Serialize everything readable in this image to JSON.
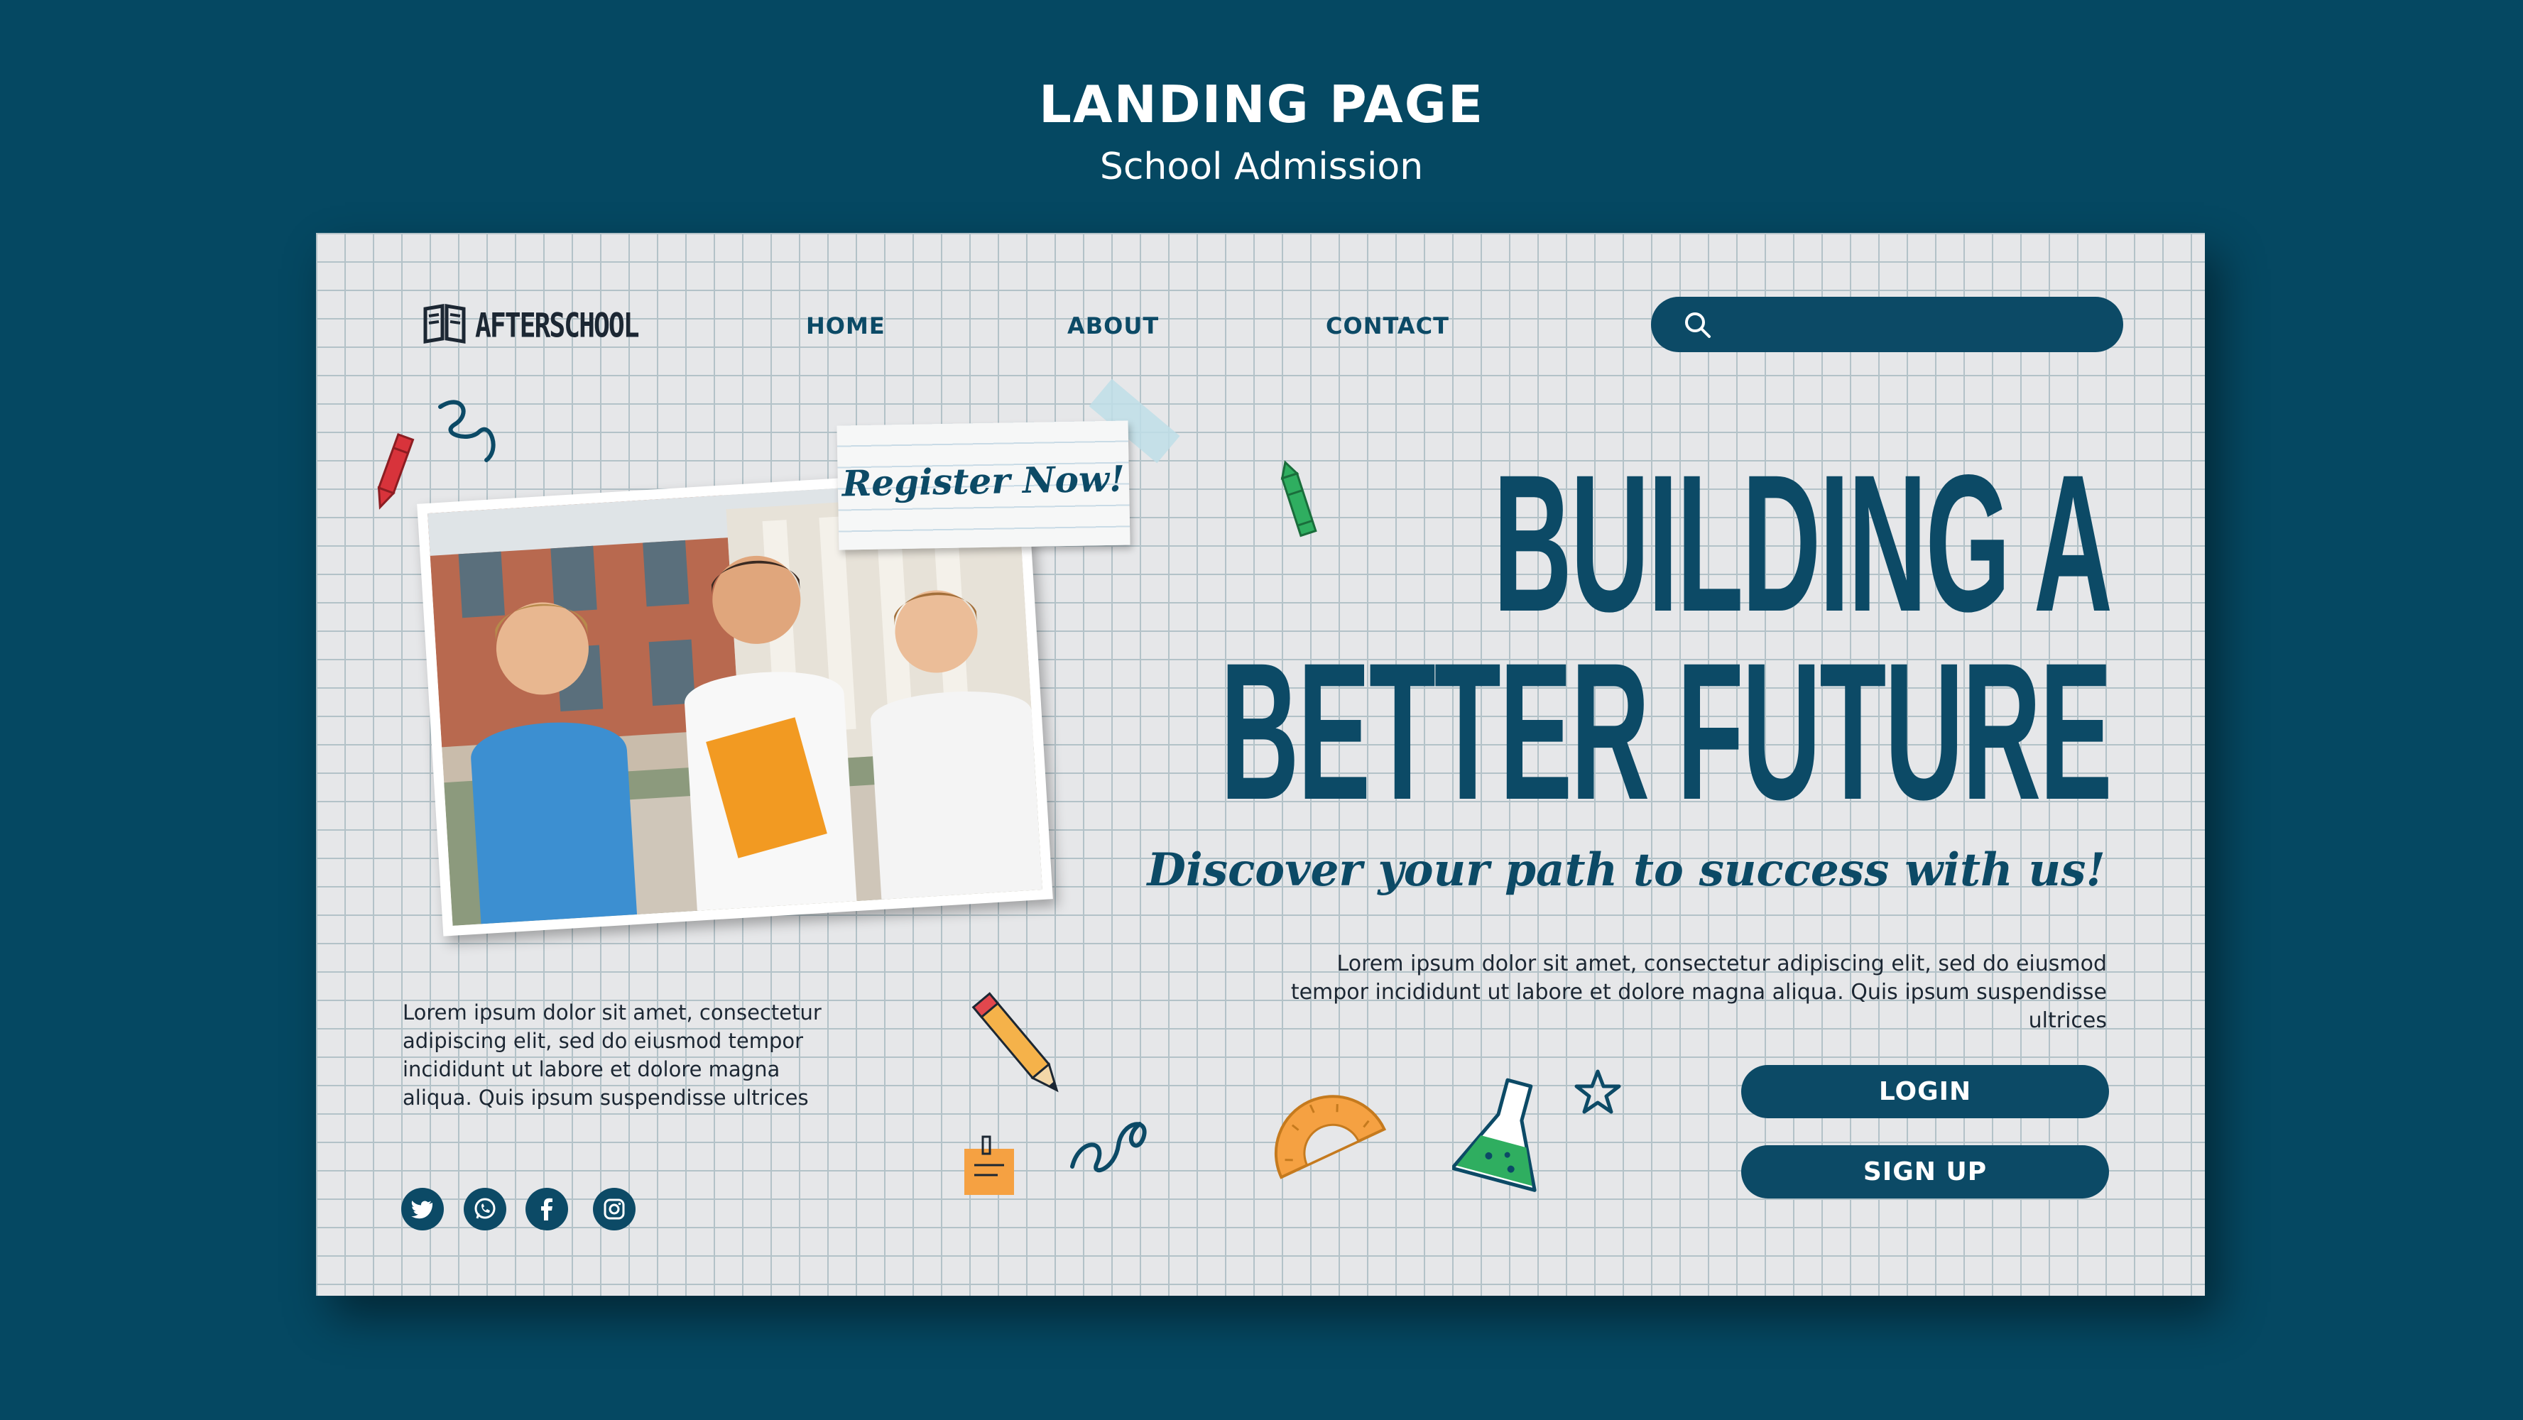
{
  "header": {
    "title": "LANDING PAGE",
    "subtitle": "School Admission"
  },
  "nav": {
    "logo_text": "AFTERSCHOOL",
    "links": [
      "HOME",
      "ABOUT",
      "CONTACT"
    ],
    "search_placeholder": ""
  },
  "hero": {
    "sticky_note": "Register Now!",
    "headline_line1": "BUILDING A",
    "headline_line2": "BETTER FUTURE",
    "tagline": "Discover your path to success with us!",
    "body_right": "Lorem ipsum dolor sit amet, consectetur adipiscing elit, sed do eiusmod tempor incididunt ut labore et dolore magna aliqua. Quis ipsum suspendisse ultrices",
    "body_left": "Lorem ipsum dolor sit amet, consectetur adipiscing elit, sed do eiusmod tempor incididunt ut labore et dolore magna aliqua. Quis ipsum suspendisse ultrices",
    "login_label": "LOGIN",
    "signup_label": "SIGN UP"
  },
  "social": [
    "twitter-icon",
    "whatsapp-icon",
    "facebook-icon",
    "instagram-icon"
  ],
  "colors": {
    "background": "#054862",
    "accent": "#0c4a66",
    "card": "#e6e7e9",
    "grid": "#b3c2c8"
  }
}
